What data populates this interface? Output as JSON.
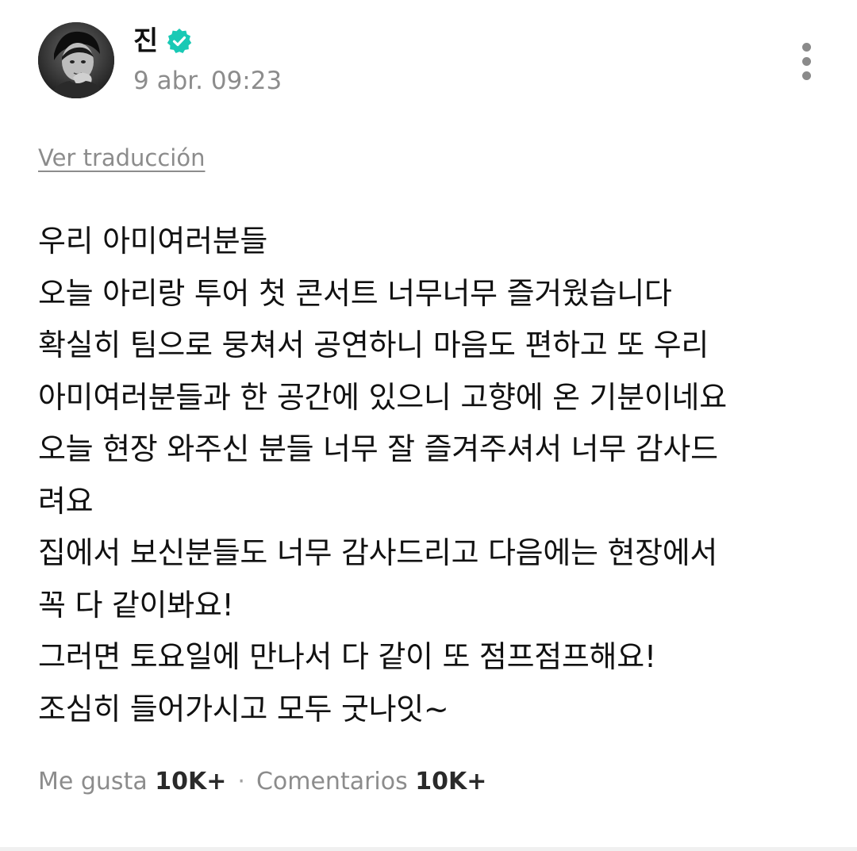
{
  "post": {
    "author": {
      "name": "진",
      "verified": true,
      "avatar_icon": "profile-photo"
    },
    "timestamp": "9 abr. 09:23",
    "translate_label": "Ver traducción",
    "body_lines": [
      "우리 아미여러분들",
      "오늘 아리랑 투어 첫 콘서트 너무너무 즐거웠습니다",
      "확실히 팀으로 뭉쳐서 공연하니 마음도 편하고 또 우리",
      "아미여러분들과 한 공간에 있으니 고향에 온 기분이네요",
      "오늘 현장 와주신 분들 너무 잘 즐겨주셔서 너무 감사드",
      "려요",
      "집에서 보신분들도 너무 감사드리고 다음에는 현장에서",
      "꼭 다 같이봐요!",
      "그러면 토요일에 만나서 다 같이 또 점프점프해요!",
      "조심히 들어가시고 모두 굿나잇~"
    ],
    "engagement": {
      "likes_label": "Me gusta",
      "likes_count": "10K+",
      "separator": "·",
      "comments_label": "Comentarios",
      "comments_count": "10K+"
    }
  },
  "icons": {
    "verified": "verified-badge-icon",
    "more": "more-vertical-icon"
  },
  "colors": {
    "verified_badge": "#19c9b5",
    "secondary_text": "#8c8c8c",
    "primary_text": "#111111"
  }
}
